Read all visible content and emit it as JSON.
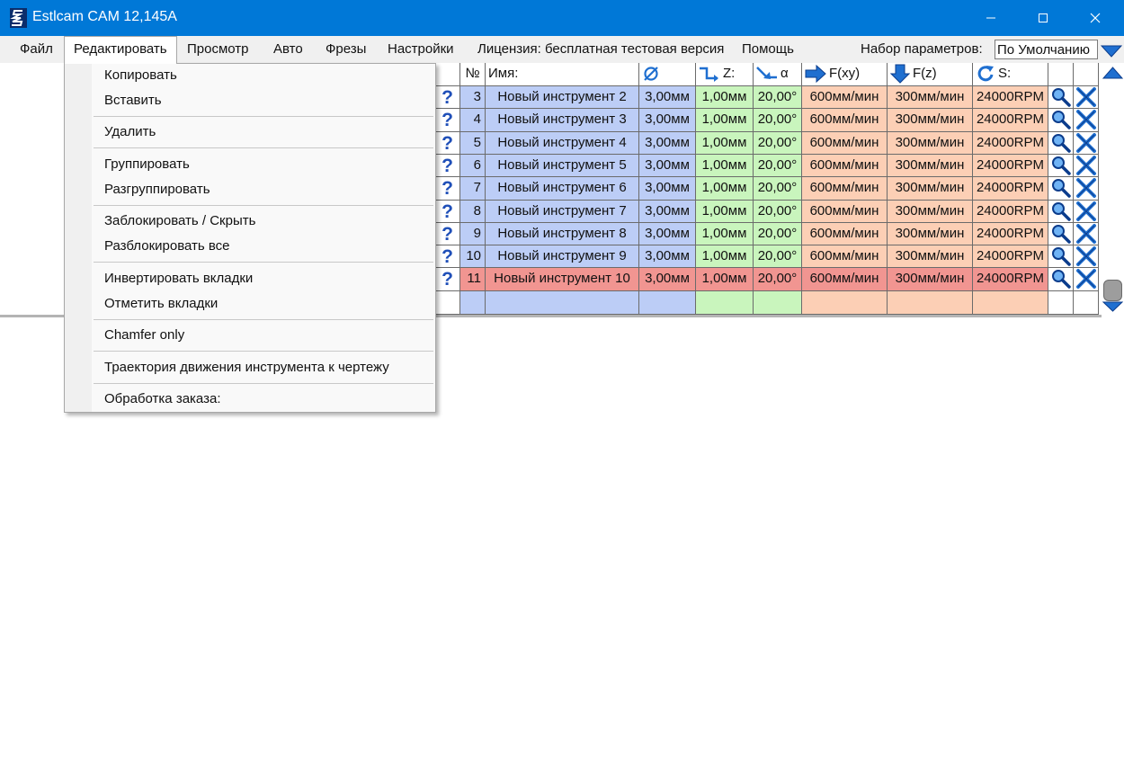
{
  "window": {
    "title": "Estlcam CAM 12,145A",
    "app_icon": "estlcam-logo-icon",
    "accent": "#0078d7"
  },
  "menubar": {
    "items": [
      "Файл",
      "Редактировать",
      "Просмотр",
      "Авто",
      "Фрезы",
      "Настройки",
      "Лицензия: бесплатная тестовая версия",
      "Помощь"
    ],
    "preset_label": "Набор параметров:",
    "preset_value": "По Умолчанию"
  },
  "edit_menu": {
    "items": [
      "Копировать",
      "Вставить",
      "Удалить",
      "Группировать",
      "Разгруппировать",
      "Заблокировать / Скрыть",
      "Разблокировать все",
      "Инвертировать вкладки",
      "Отметить вкладки",
      "Chamfer only",
      "Траектория движения инструмента к чертежу",
      "Обработка заказа:"
    ]
  },
  "table": {
    "headers": {
      "num": "№",
      "name": "Имя:",
      "diameter_icon": "diameter-icon",
      "z_label": "Z:",
      "angle_label": "α",
      "fxy_label": "F(xy)",
      "fz_label": "F(z)",
      "s_label": "S:"
    },
    "help_glyph": "?",
    "rows": [
      {
        "num": "3",
        "name": "Новый инструмент 2",
        "d": "3,00мм",
        "z": "1,00мм",
        "a": "20,00°",
        "fxy": "600мм/мин",
        "fz": "300мм/мин",
        "s": "24000RPM"
      },
      {
        "num": "4",
        "name": "Новый инструмент 3",
        "d": "3,00мм",
        "z": "1,00мм",
        "a": "20,00°",
        "fxy": "600мм/мин",
        "fz": "300мм/мин",
        "s": "24000RPM"
      },
      {
        "num": "5",
        "name": "Новый инструмент 4",
        "d": "3,00мм",
        "z": "1,00мм",
        "a": "20,00°",
        "fxy": "600мм/мин",
        "fz": "300мм/мин",
        "s": "24000RPM"
      },
      {
        "num": "6",
        "name": "Новый инструмент 5",
        "d": "3,00мм",
        "z": "1,00мм",
        "a": "20,00°",
        "fxy": "600мм/мин",
        "fz": "300мм/мин",
        "s": "24000RPM"
      },
      {
        "num": "7",
        "name": "Новый инструмент 6",
        "d": "3,00мм",
        "z": "1,00мм",
        "a": "20,00°",
        "fxy": "600мм/мин",
        "fz": "300мм/мин",
        "s": "24000RPM"
      },
      {
        "num": "8",
        "name": "Новый инструмент 7",
        "d": "3,00мм",
        "z": "1,00мм",
        "a": "20,00°",
        "fxy": "600мм/мин",
        "fz": "300мм/мин",
        "s": "24000RPM"
      },
      {
        "num": "9",
        "name": "Новый инструмент 8",
        "d": "3,00мм",
        "z": "1,00мм",
        "a": "20,00°",
        "fxy": "600мм/мин",
        "fz": "300мм/мин",
        "s": "24000RPM"
      },
      {
        "num": "10",
        "name": "Новый инструмент 9",
        "d": "3,00мм",
        "z": "1,00мм",
        "a": "20,00°",
        "fxy": "600мм/мин",
        "fz": "300мм/мин",
        "s": "24000RPM"
      },
      {
        "num": "11",
        "name": "Новый инструмент 10",
        "d": "3,00мм",
        "z": "1,00мм",
        "a": "20,00°",
        "fxy": "600мм/мин",
        "fz": "300мм/мин",
        "s": "24000RPM",
        "selected": true
      }
    ]
  },
  "colors": {
    "param_blue": "#bccdf6",
    "param_green": "#c9f5bd",
    "param_peach": "#fccfb5",
    "selected_row": "#f19591",
    "icon_blue": "#1f6fd0"
  }
}
